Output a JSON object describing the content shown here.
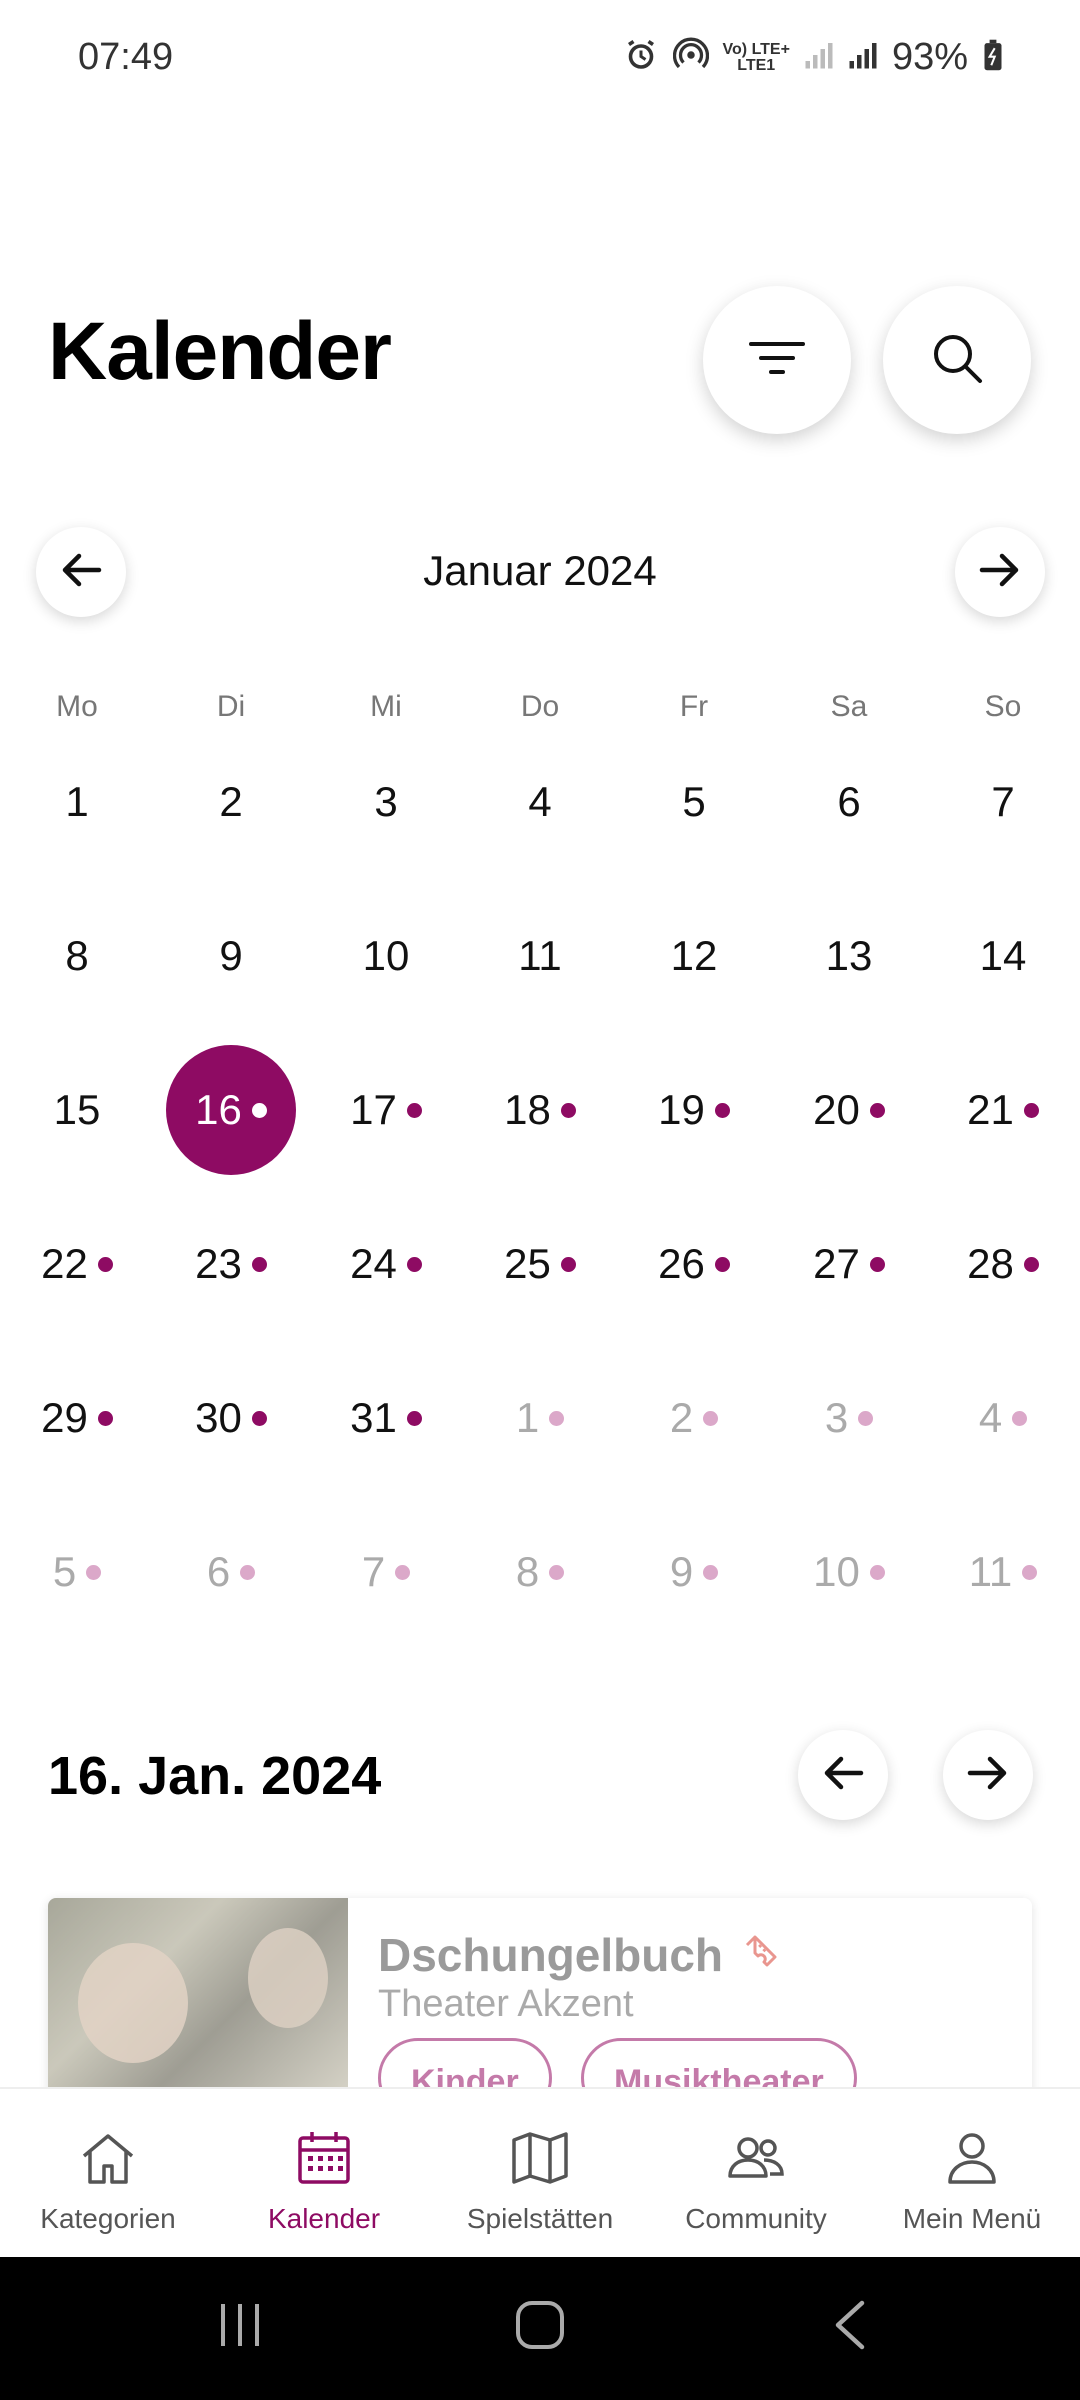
{
  "status_bar": {
    "time": "07:49",
    "signal_label_top": "Vo) LTE+",
    "signal_label_bottom": "LTE1",
    "battery_pct": "93%"
  },
  "header": {
    "title": "Kalender",
    "filter_icon": "filter-icon",
    "search_icon": "search-icon"
  },
  "month_nav": {
    "label": "Januar 2024"
  },
  "weekdays": [
    "Mo",
    "Di",
    "Mi",
    "Do",
    "Fr",
    "Sa",
    "So"
  ],
  "calendar_days": [
    {
      "n": "1",
      "dot": false,
      "outside": false
    },
    {
      "n": "2",
      "dot": false,
      "outside": false
    },
    {
      "n": "3",
      "dot": false,
      "outside": false
    },
    {
      "n": "4",
      "dot": false,
      "outside": false
    },
    {
      "n": "5",
      "dot": false,
      "outside": false
    },
    {
      "n": "6",
      "dot": false,
      "outside": false
    },
    {
      "n": "7",
      "dot": false,
      "outside": false
    },
    {
      "n": "8",
      "dot": false,
      "outside": false
    },
    {
      "n": "9",
      "dot": false,
      "outside": false
    },
    {
      "n": "10",
      "dot": false,
      "outside": false
    },
    {
      "n": "11",
      "dot": false,
      "outside": false
    },
    {
      "n": "12",
      "dot": false,
      "outside": false
    },
    {
      "n": "13",
      "dot": false,
      "outside": false
    },
    {
      "n": "14",
      "dot": false,
      "outside": false
    },
    {
      "n": "15",
      "dot": false,
      "outside": false
    },
    {
      "n": "16",
      "dot": true,
      "outside": false,
      "selected": true
    },
    {
      "n": "17",
      "dot": true,
      "outside": false
    },
    {
      "n": "18",
      "dot": true,
      "outside": false
    },
    {
      "n": "19",
      "dot": true,
      "outside": false
    },
    {
      "n": "20",
      "dot": true,
      "outside": false
    },
    {
      "n": "21",
      "dot": true,
      "outside": false
    },
    {
      "n": "22",
      "dot": true,
      "outside": false
    },
    {
      "n": "23",
      "dot": true,
      "outside": false
    },
    {
      "n": "24",
      "dot": true,
      "outside": false
    },
    {
      "n": "25",
      "dot": true,
      "outside": false
    },
    {
      "n": "26",
      "dot": true,
      "outside": false
    },
    {
      "n": "27",
      "dot": true,
      "outside": false
    },
    {
      "n": "28",
      "dot": true,
      "outside": false
    },
    {
      "n": "29",
      "dot": true,
      "outside": false
    },
    {
      "n": "30",
      "dot": true,
      "outside": false
    },
    {
      "n": "31",
      "dot": true,
      "outside": false
    },
    {
      "n": "1",
      "dot": true,
      "outside": true
    },
    {
      "n": "2",
      "dot": true,
      "outside": true
    },
    {
      "n": "3",
      "dot": true,
      "outside": true
    },
    {
      "n": "4",
      "dot": true,
      "outside": true
    },
    {
      "n": "5",
      "dot": true,
      "outside": true
    },
    {
      "n": "6",
      "dot": true,
      "outside": true
    },
    {
      "n": "7",
      "dot": true,
      "outside": true
    },
    {
      "n": "8",
      "dot": true,
      "outside": true
    },
    {
      "n": "9",
      "dot": true,
      "outside": true
    },
    {
      "n": "10",
      "dot": true,
      "outside": true
    },
    {
      "n": "11",
      "dot": true,
      "outside": true
    }
  ],
  "selected_date": {
    "heading": "16. Jan. 2024"
  },
  "event": {
    "title": "Dschungelbuch",
    "venue": "Theater Akzent",
    "tags": [
      "Kinder",
      "Musiktheater"
    ],
    "ticket_icon": "ticket-icon"
  },
  "bottom_nav": [
    {
      "label": "Kategorien",
      "icon": "home-icon",
      "active": false
    },
    {
      "label": "Kalender",
      "icon": "calendar-icon",
      "active": true
    },
    {
      "label": "Spielstätten",
      "icon": "map-icon",
      "active": false
    },
    {
      "label": "Community",
      "icon": "people-icon",
      "active": false
    },
    {
      "label": "Mein Menü",
      "icon": "person-icon",
      "active": false
    }
  ],
  "colors": {
    "accent": "#8e0b63",
    "accent_light": "#dba8c9",
    "chip": "#c47aa9"
  }
}
